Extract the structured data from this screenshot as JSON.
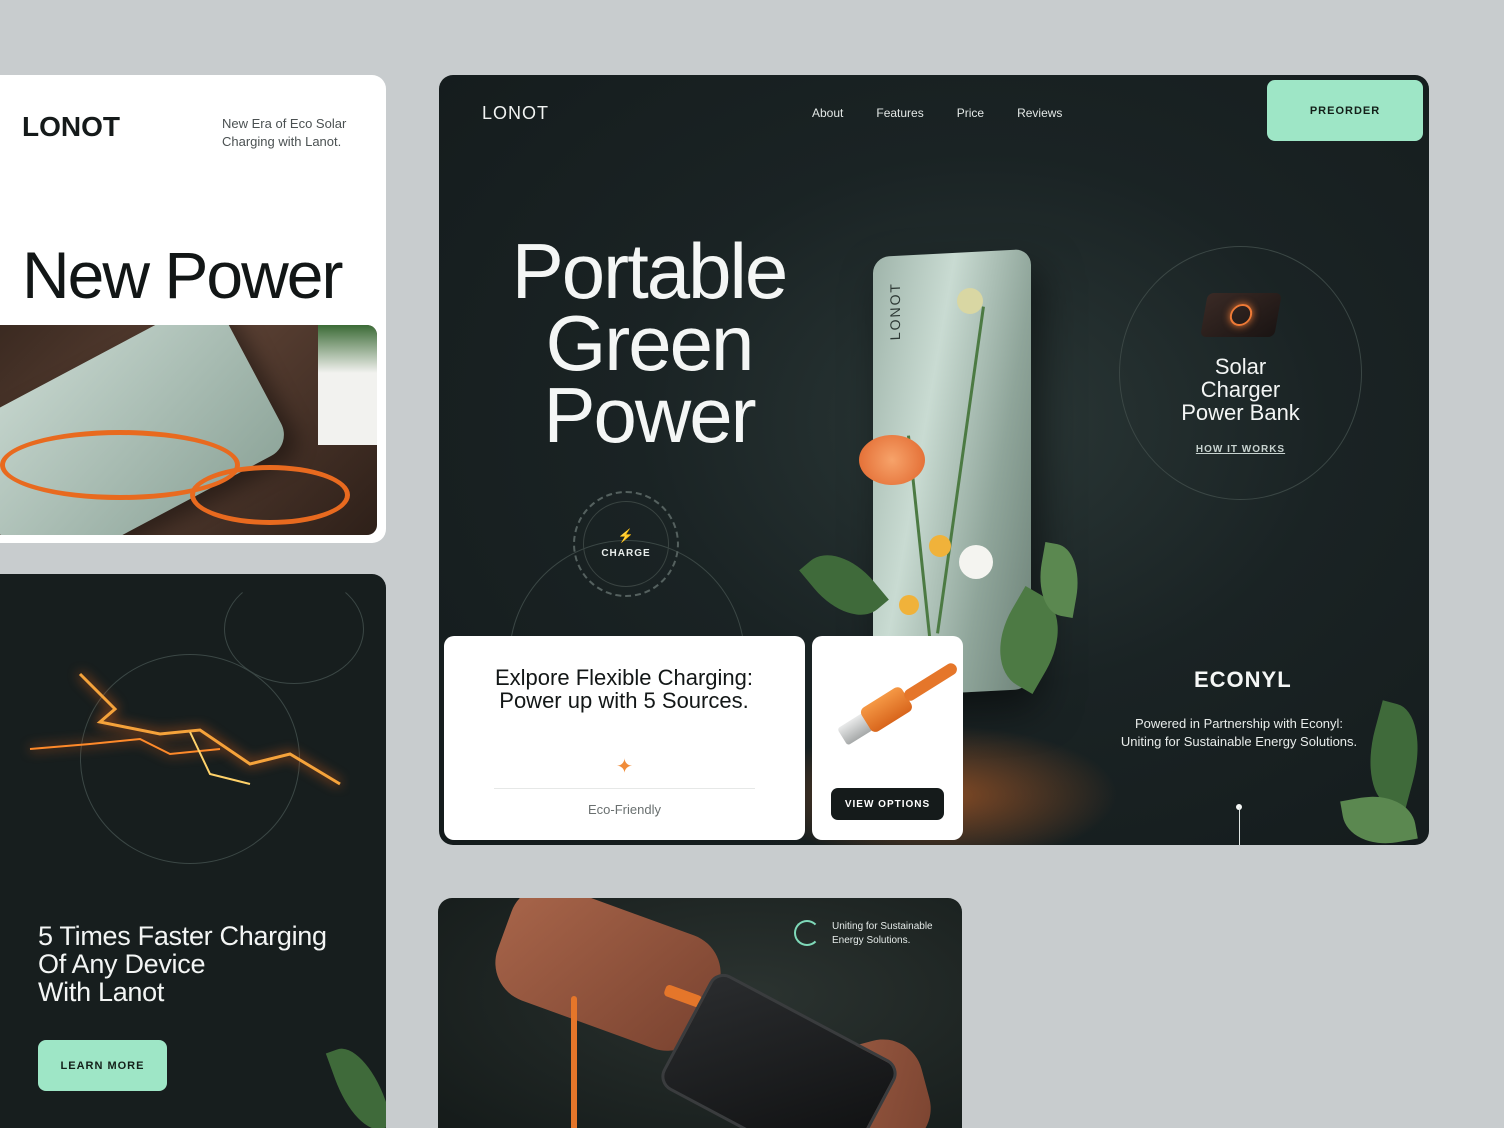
{
  "brand": {
    "name": "LONOT"
  },
  "card_new_power": {
    "tagline": "New Era of Eco Solar Charging with Lanot.",
    "title": "New Power"
  },
  "card_faster": {
    "headline_lines": [
      "5 Times Faster Charging",
      "Of Any Device",
      "With Lanot"
    ],
    "button": "LEARN MORE"
  },
  "hero": {
    "nav": [
      "About",
      "Features",
      "Price",
      "Reviews"
    ],
    "preorder": "PREORDER",
    "title_lines": [
      "Portable",
      "Green",
      "Power"
    ],
    "charge_label": "CHARGE",
    "product": {
      "title_lines": [
        "Solar",
        "Charger",
        "Power Bank"
      ],
      "link": "HOW IT WORKS"
    },
    "partner": {
      "logo": "ECONYL",
      "text": "Powered in Partnership with Econyl: Uniting for Sustainable Energy Solutions."
    },
    "explore": {
      "title": "Exlpore Flexible Charging: Power up with 5 Sources.",
      "caption": "Eco-Friendly"
    },
    "options_button": "VIEW OPTIONS"
  },
  "card_photo": {
    "badge": "Uniting for Sustainable Energy Solutions."
  },
  "colors": {
    "background": "#c8ccce",
    "dark": "#171e1e",
    "mint": "#9ee6c6",
    "accent_orange": "#f08c3a"
  },
  "icons": [
    "bolt-icon",
    "sparkle-icon",
    "swirl-icon"
  ]
}
